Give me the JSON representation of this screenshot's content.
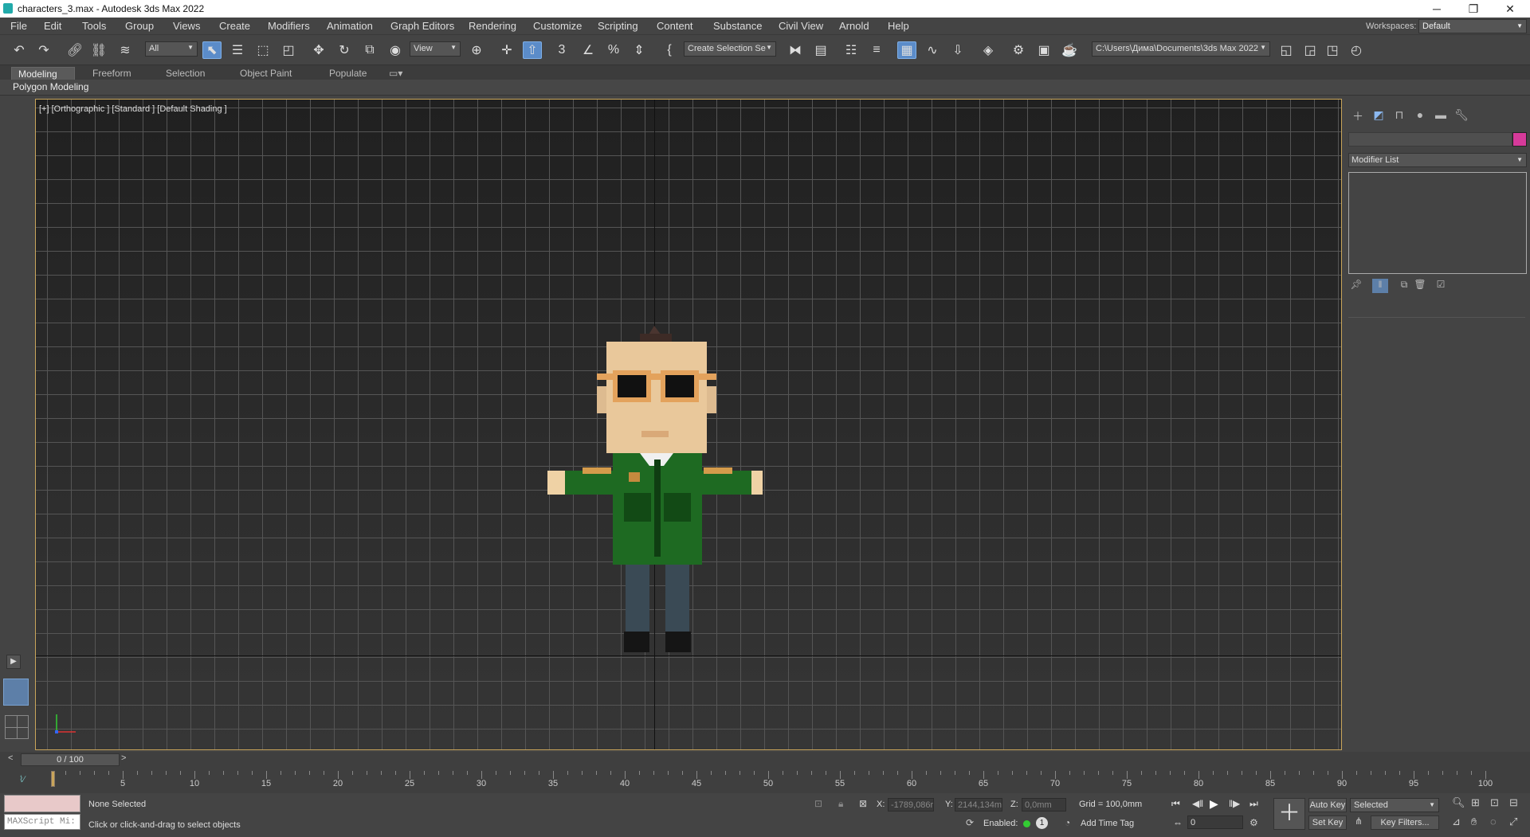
{
  "window": {
    "title": "characters_3.max - Autodesk 3ds Max 2022",
    "minimize": "─",
    "restore": "❐",
    "close": "✕"
  },
  "menu": [
    "File",
    "Edit",
    "Tools",
    "Group",
    "Views",
    "Create",
    "Modifiers",
    "Animation",
    "Graph Editors",
    "Rendering",
    "Customize",
    "Scripting",
    "Content",
    "Substance",
    "Civil View",
    "Arnold",
    "Help"
  ],
  "workspace": {
    "label": "Workspaces:",
    "value": "Default"
  },
  "toolbar": {
    "selection_filter": "All",
    "ref_coord": "View",
    "named_selection": "Create Selection Se",
    "project_path": "C:\\Users\\Дима\\Documents\\3ds Max 2022"
  },
  "ribbon": {
    "tabs": [
      "Modeling",
      "Freeform",
      "Selection",
      "Object Paint",
      "Populate"
    ],
    "active": "Modeling",
    "sub_label": "Polygon Modeling"
  },
  "viewport": {
    "label": "[+] [Orthographic ] [Standard ] [Default Shading ]"
  },
  "command_panel": {
    "modifier_list": "Modifier List",
    "color": "#d63a9a"
  },
  "timeline": {
    "slider": "0 / 100",
    "ticks": [
      "5",
      "10",
      "15",
      "20",
      "25",
      "30",
      "35",
      "40",
      "45",
      "50",
      "55",
      "60",
      "65",
      "70",
      "75",
      "80",
      "85",
      "90",
      "95",
      "100"
    ]
  },
  "status": {
    "selection": "None Selected",
    "prompt": "Click or click-and-drag to select objects",
    "maxscript_placeholder": "MAXScript Mi:",
    "x_label": "X:",
    "x_value": "-1789,086r",
    "y_label": "Y:",
    "y_value": "2144,134m",
    "z_label": "Z:",
    "z_value": "0,0mm",
    "grid": "Grid = 100,0mm",
    "enabled": "Enabled:",
    "add_time_tag": "Add Time Tag",
    "auto_key": "Auto Key",
    "key_mode": "Selected",
    "set_key": "Set Key",
    "key_filters": "Key Filters...",
    "frame": "0"
  }
}
